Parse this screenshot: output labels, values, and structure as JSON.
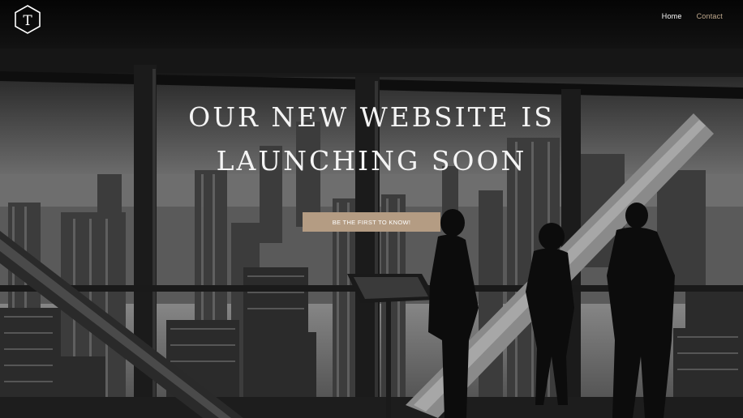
{
  "header": {
    "logo_letter": "T",
    "nav": [
      {
        "label": "Home"
      },
      {
        "label": "Contact"
      }
    ]
  },
  "hero": {
    "headline_line1": "OUR NEW WEBSITE IS",
    "headline_line2": "LAUNCHING SOON",
    "cta_label": "BE THE FIRST TO KNOW!"
  },
  "colors": {
    "accent": "#b49c83",
    "contact_link": "#c2ab8f",
    "text": "#ffffff"
  },
  "icons": [
    "logo-hexagon-icon"
  ]
}
